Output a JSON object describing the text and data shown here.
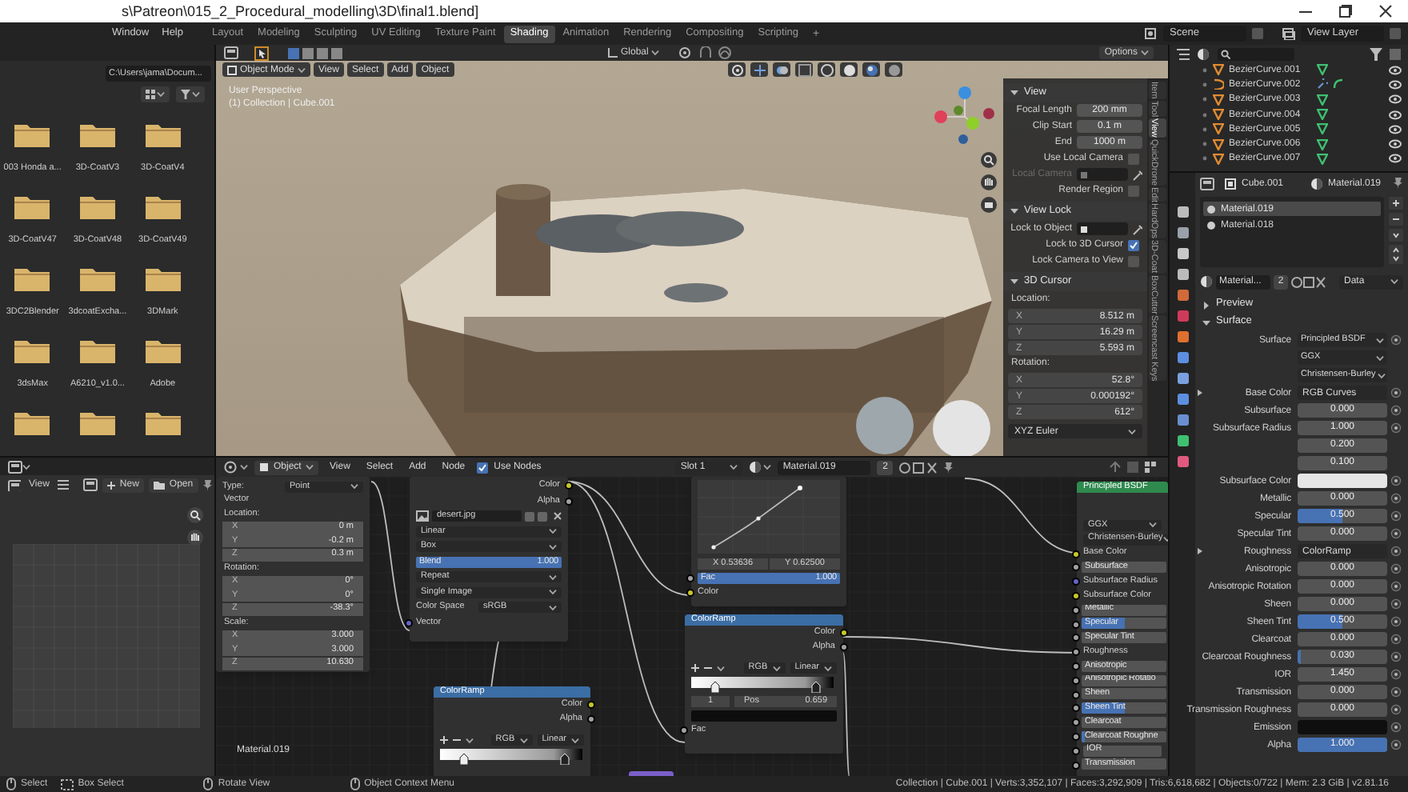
{
  "window": {
    "title": "s\\Patreon\\015_2_Procedural_modelling\\3D\\final1.blend]"
  },
  "menu": [
    "Window",
    "Help"
  ],
  "workspaces": [
    {
      "label": "Layout",
      "selected": false
    },
    {
      "label": "Modeling",
      "selected": false
    },
    {
      "label": "Sculpting",
      "selected": false
    },
    {
      "label": "UV Editing",
      "selected": false
    },
    {
      "label": "Texture Paint",
      "selected": false
    },
    {
      "label": "Shading",
      "selected": true
    },
    {
      "label": "Animation",
      "selected": false
    },
    {
      "label": "Rendering",
      "selected": false
    },
    {
      "label": "Compositing",
      "selected": false
    },
    {
      "label": "Scripting",
      "selected": false
    }
  ],
  "add_workspace": "+",
  "scene": "Scene",
  "view_layer": "View Layer",
  "file_browser": {
    "path": "C:\\Users\\jama\\Docum...",
    "folders": [
      "003 Honda a...",
      "3D-CoatV3",
      "3D-CoatV4",
      "3D-CoatV47",
      "3D-CoatV48",
      "3D-CoatV49",
      "3DC2Blender",
      "3dcoatExcha...",
      "3DMark",
      "3dsMax",
      "A6210_v1.0...",
      "Adobe"
    ]
  },
  "image_editor": {
    "menu": "View",
    "new": "New",
    "open": "Open"
  },
  "viewport": {
    "mode": "Object Mode",
    "menus": [
      "View",
      "Select",
      "Add",
      "Object"
    ],
    "orientation": "Global",
    "options": "Options",
    "info": [
      "User Perspective",
      "(1) Collection | Cube.001"
    ]
  },
  "sidebar": {
    "tabs": [
      {
        "label": "Item",
        "selected": false
      },
      {
        "label": "Tool",
        "selected": false
      },
      {
        "label": "View",
        "selected": true
      },
      {
        "label": "QuickDrone",
        "selected": false
      },
      {
        "label": "Edit",
        "selected": false
      },
      {
        "label": "HardOps",
        "selected": false
      },
      {
        "label": "3D-Coat",
        "selected": false
      },
      {
        "label": "BoxCutter",
        "selected": false
      },
      {
        "label": "Screencast Keys",
        "selected": false
      }
    ],
    "rows": [
      {
        "kind": "section",
        "label": "View",
        "expanded": true
      },
      {
        "kind": "field",
        "label": "Focal Length",
        "value": "200 mm"
      },
      {
        "kind": "field",
        "label": "Clip Start",
        "value": "0.1 m"
      },
      {
        "kind": "field",
        "label": "End",
        "value": "1000 m"
      },
      {
        "kind": "check",
        "label": "Use Local Camera",
        "checked": false
      },
      {
        "kind": "picker",
        "label": "Local Camera",
        "disabled": true
      },
      {
        "kind": "check",
        "label": "Render Region",
        "checked": false
      },
      {
        "kind": "section",
        "label": "View Lock",
        "expanded": true
      },
      {
        "kind": "picker",
        "label": "Lock to Object",
        "disabled": false
      },
      {
        "kind": "check",
        "label": "Lock to 3D Cursor",
        "checked": true
      },
      {
        "kind": "check",
        "label": "Lock Camera to View",
        "checked": false
      },
      {
        "kind": "section",
        "label": "3D Cursor",
        "expanded": true
      },
      {
        "kind": "caption",
        "label": "Location:"
      },
      {
        "kind": "vector",
        "label": "X",
        "value": "8.512 m"
      },
      {
        "kind": "vector",
        "label": "Y",
        "value": "16.29 m"
      },
      {
        "kind": "vector",
        "label": "Z",
        "value": "5.593 m"
      },
      {
        "kind": "caption",
        "label": "Rotation:"
      },
      {
        "kind": "vector",
        "label": "X",
        "value": "52.8°"
      },
      {
        "kind": "vector",
        "label": "Y",
        "value": "0.000192°"
      },
      {
        "kind": "vector",
        "label": "Z",
        "value": "612°"
      },
      {
        "kind": "dropdown",
        "value": "XYZ Euler"
      }
    ]
  },
  "outliner": {
    "items": [
      {
        "label": "BezierCurve.001",
        "kind": "curve"
      },
      {
        "label": "BezierCurve.002",
        "kind": "modified"
      },
      {
        "label": "BezierCurve.003",
        "kind": "curve"
      },
      {
        "label": "BezierCurve.004",
        "kind": "curve"
      },
      {
        "label": "BezierCurve.005",
        "kind": "curve"
      },
      {
        "label": "BezierCurve.006",
        "kind": "curve"
      },
      {
        "label": "BezierCurve.007",
        "kind": "curve"
      }
    ]
  },
  "properties": {
    "object": "Cube.001",
    "material": "Material.019",
    "slots": [
      {
        "label": "Material.019",
        "selected": true
      },
      {
        "label": "Material.018",
        "selected": false
      }
    ],
    "datablock": {
      "name": "Material...",
      "users": "2",
      "link": "Data"
    },
    "sections": [
      {
        "label": "Preview",
        "expanded": false
      },
      {
        "label": "Surface",
        "expanded": true
      }
    ],
    "rows": [
      {
        "kind": "dropdown",
        "label": "Surface",
        "value": "Principled BSDF"
      },
      {
        "kind": "dropdown",
        "value": "GGX"
      },
      {
        "kind": "dropdown",
        "value": "Christensen-Burley"
      },
      {
        "kind": "link",
        "label": "Base Color",
        "value": "RGB Curves"
      },
      {
        "kind": "slider",
        "label": "Subsurface",
        "value": "0.000",
        "level": 0
      },
      {
        "kind": "number",
        "label": "Subsurface Radius",
        "value": "1.000"
      },
      {
        "kind": "number",
        "value": "0.200"
      },
      {
        "kind": "number",
        "value": "0.100"
      },
      {
        "kind": "color",
        "label": "Subsurface Color",
        "color": "#e6e6e6"
      },
      {
        "kind": "slider",
        "label": "Metallic",
        "value": "0.000",
        "level": 0
      },
      {
        "kind": "slider",
        "label": "Specular",
        "value": "0.500",
        "level": 0.5
      },
      {
        "kind": "slider",
        "label": "Specular Tint",
        "value": "0.000",
        "level": 0
      },
      {
        "kind": "link",
        "label": "Roughness",
        "value": "ColorRamp"
      },
      {
        "kind": "slider",
        "label": "Anisotropic",
        "value": "0.000",
        "level": 0
      },
      {
        "kind": "slider",
        "label": "Anisotropic Rotation",
        "value": "0.000",
        "level": 0
      },
      {
        "kind": "slider",
        "label": "Sheen",
        "value": "0.000",
        "level": 0
      },
      {
        "kind": "slider",
        "label": "Sheen Tint",
        "value": "0.500",
        "level": 0.5
      },
      {
        "kind": "slider",
        "label": "Clearcoat",
        "value": "0.000",
        "level": 0
      },
      {
        "kind": "slider",
        "label": "Clearcoat Roughness",
        "value": "0.030",
        "level": 0.03
      },
      {
        "kind": "number",
        "label": "IOR",
        "value": "1.450"
      },
      {
        "kind": "slider",
        "label": "Transmission",
        "value": "0.000",
        "level": 0
      },
      {
        "kind": "slider",
        "label": "Transmission Roughness",
        "value": "0.000",
        "level": 0
      },
      {
        "kind": "color",
        "label": "Emission",
        "color": "#0f0f0f"
      },
      {
        "kind": "slider",
        "label": "Alpha",
        "value": "1.000",
        "level": 1
      }
    ]
  },
  "node_editor": {
    "object": "Object",
    "menus": [
      "View",
      "Select",
      "Add",
      "Node"
    ],
    "use_nodes": {
      "label": "Use Nodes",
      "checked": true
    },
    "slot": "Slot 1",
    "material": "Material.019",
    "users": "2",
    "frame_label": "Material.019",
    "nodes": [
      {
        "kind": "mapping",
        "rows": [
          {
            "kind": "prop",
            "label": "Type:",
            "value": "Point"
          },
          {
            "kind": "caption",
            "label": "Vector"
          },
          {
            "kind": "caption",
            "label": "Location:"
          },
          {
            "kind": "field",
            "label": "X",
            "value": "0 m"
          },
          {
            "kind": "field",
            "label": "Y",
            "value": "-0.2 m"
          },
          {
            "kind": "field",
            "label": "Z",
            "value": "0.3 m"
          },
          {
            "kind": "caption",
            "label": "Rotation:"
          },
          {
            "kind": "field",
            "label": "X",
            "value": "0°"
          },
          {
            "kind": "field",
            "label": "Y",
            "value": "0°"
          },
          {
            "kind": "field",
            "label": "Z",
            "value": "-38.3°"
          },
          {
            "kind": "caption",
            "label": "Scale:"
          },
          {
            "kind": "field",
            "label": "X",
            "value": "3.000"
          },
          {
            "kind": "field",
            "label": "Y",
            "value": "3.000"
          },
          {
            "kind": "field",
            "label": "Z",
            "value": "10.630"
          }
        ]
      },
      {
        "kind": "image_texture",
        "rows": [
          {
            "kind": "output",
            "label": "Color",
            "color": "#c7c729"
          },
          {
            "kind": "output",
            "label": "Alpha",
            "color": "#a1a1a1"
          },
          {
            "kind": "image",
            "value": "desert.jpg"
          },
          {
            "kind": "dropdown",
            "value": "Linear"
          },
          {
            "kind": "dropdown",
            "value": "Box"
          },
          {
            "kind": "slider",
            "label": "Blend",
            "value": "1.000",
            "level": 1
          },
          {
            "kind": "dropdown",
            "value": "Repeat"
          },
          {
            "kind": "dropdown",
            "value": "Single Image"
          },
          {
            "kind": "prop",
            "label": "Color Space",
            "value": "sRGB"
          },
          {
            "kind": "input",
            "label": "Vector",
            "color": "#6363c7"
          }
        ]
      },
      {
        "kind": "curves",
        "rows": [
          {
            "kind": "curve"
          },
          {
            "kind": "readout",
            "x": "X 0.53636",
            "y": "Y 0.62500"
          },
          {
            "kind": "slider",
            "label": "Fac",
            "value": "1.000",
            "level": 1,
            "color": "#a1a1a1"
          },
          {
            "kind": "input",
            "label": "Color",
            "color": "#c7c729"
          }
        ]
      },
      {
        "kind": "color_ramp",
        "title": "ColorRamp",
        "rows": [
          {
            "kind": "output",
            "label": "Color",
            "color": "#c7c729"
          },
          {
            "kind": "output",
            "label": "Alpha",
            "color": "#a1a1a1"
          },
          {
            "kind": "ramp_controls",
            "mode": "RGB",
            "interpolation": "Linear"
          },
          {
            "kind": "ramp"
          },
          {
            "kind": "stop",
            "index": "1",
            "label": "Pos",
            "value": "0.659"
          },
          {
            "kind": "swatch",
            "color": "#0d0d0d"
          },
          {
            "kind": "input",
            "label": "Fac",
            "color": "#a1a1a1"
          }
        ]
      },
      {
        "kind": "color_ramp",
        "title": "ColorRamp",
        "rows": [
          {
            "kind": "output",
            "label": "Color",
            "color": "#c7c729"
          },
          {
            "kind": "output",
            "label": "Alpha",
            "color": "#a1a1a1"
          },
          {
            "kind": "ramp_controls",
            "mode": "RGB",
            "interpolation": "Linear"
          },
          {
            "kind": "ramp"
          }
        ]
      },
      {
        "kind": "bsdf",
        "title": "Principled BSDF",
        "rows": [
          {
            "kind": "dropdown",
            "value": "GGX"
          },
          {
            "kind": "dropdown",
            "value": "Christensen-Burley"
          },
          {
            "kind": "input",
            "label": "Base Color",
            "color": "#c7c729"
          },
          {
            "kind": "slider",
            "label": "Subsurface",
            "level": 0,
            "color": "#a1a1a1"
          },
          {
            "kind": "input",
            "label": "Subsurface Radius",
            "color": "#6363c7"
          },
          {
            "kind": "input",
            "label": "Subsurface Color",
            "color": "#c7c729"
          },
          {
            "kind": "slider",
            "label": "Metallic",
            "level": 0,
            "color": "#a1a1a1"
          },
          {
            "kind": "slider",
            "label": "Specular",
            "level": 0.5,
            "color": "#a1a1a1"
          },
          {
            "kind": "slider",
            "label": "Specular Tint",
            "level": 0,
            "color": "#a1a1a1"
          },
          {
            "kind": "input",
            "label": "Roughness",
            "color": "#a1a1a1"
          },
          {
            "kind": "slider",
            "label": "Anisotropic",
            "level": 0,
            "color": "#a1a1a1"
          },
          {
            "kind": "slider",
            "label": "Anisotropic Rotatio",
            "level": 0,
            "color": "#a1a1a1"
          },
          {
            "kind": "slider",
            "label": "Sheen",
            "level": 0,
            "color": "#a1a1a1"
          },
          {
            "kind": "slider",
            "label": "Sheen Tint",
            "level": 0.5,
            "color": "#a1a1a1"
          },
          {
            "kind": "slider",
            "label": "Clearcoat",
            "level": 0,
            "color": "#a1a1a1"
          },
          {
            "kind": "slider",
            "label": "Clearcoat Roughne",
            "level": 0.03,
            "color": "#a1a1a1"
          },
          {
            "kind": "number",
            "label": "IOR",
            "color": "#a1a1a1"
          },
          {
            "kind": "slider",
            "label": "Transmission",
            "level": 0,
            "color": "#a1a1a1"
          }
        ]
      }
    ]
  },
  "status_bar": {
    "hints": [
      {
        "kind": "mouse",
        "label": "Select"
      },
      {
        "kind": "box",
        "label": "Box Select"
      },
      {
        "kind": "mouse",
        "label": "Rotate View"
      },
      {
        "kind": "mouse",
        "label": "Object Context Menu"
      }
    ],
    "stats": "Collection | Cube.001 | Verts:3,352,107 | Faces:3,292,909 | Tris:6,618,682 | Objects:0/722 | Mem: 2.3 GiB | v2.81.16"
  }
}
